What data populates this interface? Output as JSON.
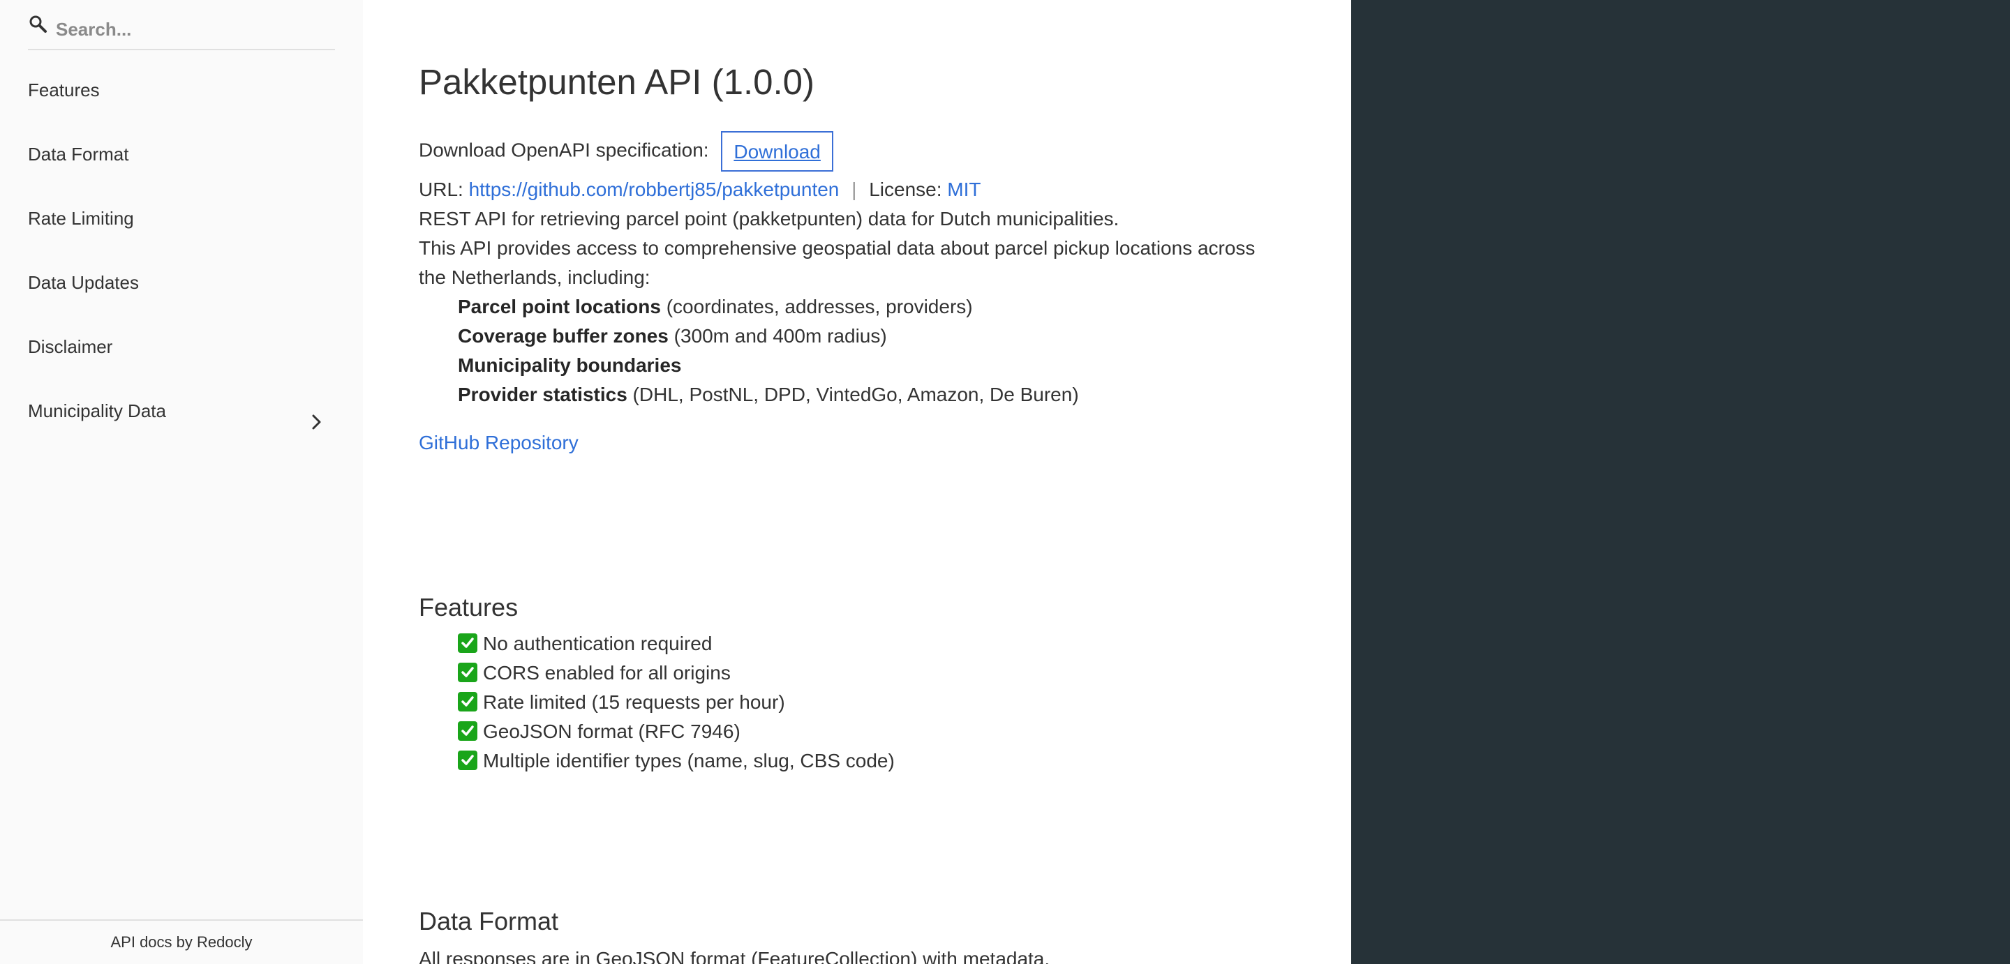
{
  "search": {
    "placeholder": "Search..."
  },
  "sidebar": {
    "items": [
      {
        "label": "Features"
      },
      {
        "label": "Data Format"
      },
      {
        "label": "Rate Limiting"
      },
      {
        "label": "Data Updates"
      },
      {
        "label": "Disclaimer"
      },
      {
        "label": "Municipality Data"
      }
    ],
    "footer": "API docs by Redocly"
  },
  "info": {
    "title": "Pakketpunten API (1.0.0)",
    "download_label": "Download OpenAPI specification:",
    "download_button": "Download",
    "url_label": "URL:",
    "url": "https://github.com/robbertj85/pakketpunten",
    "separator": "|",
    "license_label": "License:",
    "license": "MIT",
    "summary": "REST API for retrieving parcel point (pakketpunten) data for Dutch municipalities.",
    "description_line1": "This API provides access to comprehensive geospatial data about parcel pickup locations across",
    "description_line2": "the Netherlands, including:",
    "bullets": [
      {
        "bold": "Parcel point locations",
        "rest": " (coordinates, addresses, providers)"
      },
      {
        "bold": "Coverage buffer zones",
        "rest": " (300m and 400m radius)"
      },
      {
        "bold": "Municipality boundaries",
        "rest": ""
      },
      {
        "bold": "Provider statistics",
        "rest": " (DHL, PostNL, DPD, VintedGo, Amazon, De Buren)"
      }
    ],
    "github_link": "GitHub Repository"
  },
  "features": {
    "title": "Features",
    "items": [
      "No authentication required",
      "CORS enabled for all origins",
      "Rate limited (15 requests per hour)",
      "GeoJSON format (RFC 7946)",
      "Multiple identifier types (name, slug, CBS code)"
    ]
  },
  "data_format": {
    "title": "Data Format",
    "text": "All responses are in GeoJSON format (FeatureCollection) with metadata."
  },
  "colors": {
    "sidebar_bg": "#fafafa",
    "right_panel_bg": "#263238",
    "link": "#2f6fd8",
    "check_green": "#1aa51a"
  }
}
